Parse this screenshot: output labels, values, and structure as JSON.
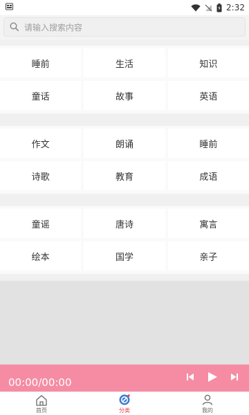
{
  "status_bar": {
    "time": "2:32"
  },
  "search": {
    "placeholder": "请输入搜索内容"
  },
  "sections": [
    {
      "items": [
        "睡前",
        "生活",
        "知识",
        "童话",
        "故事",
        "英语"
      ]
    },
    {
      "items": [
        "作文",
        "朗诵",
        "睡前",
        "诗歌",
        "教育",
        "成语"
      ]
    },
    {
      "items": [
        "童谣",
        "唐诗",
        "寓言",
        "绘本",
        "国学",
        "亲子"
      ]
    }
  ],
  "player": {
    "time": "00:00/00:00"
  },
  "tabs": [
    {
      "label": "首页",
      "icon": "home-icon",
      "active": false
    },
    {
      "label": "分类",
      "icon": "category-icon",
      "active": true
    },
    {
      "label": "我的",
      "icon": "user-icon",
      "active": false
    }
  ],
  "colors": {
    "accent": "#f58ca4",
    "active_tab": "#e33a4a",
    "band": "#f0f0f0",
    "empty_area": "#e2e2e2"
  }
}
